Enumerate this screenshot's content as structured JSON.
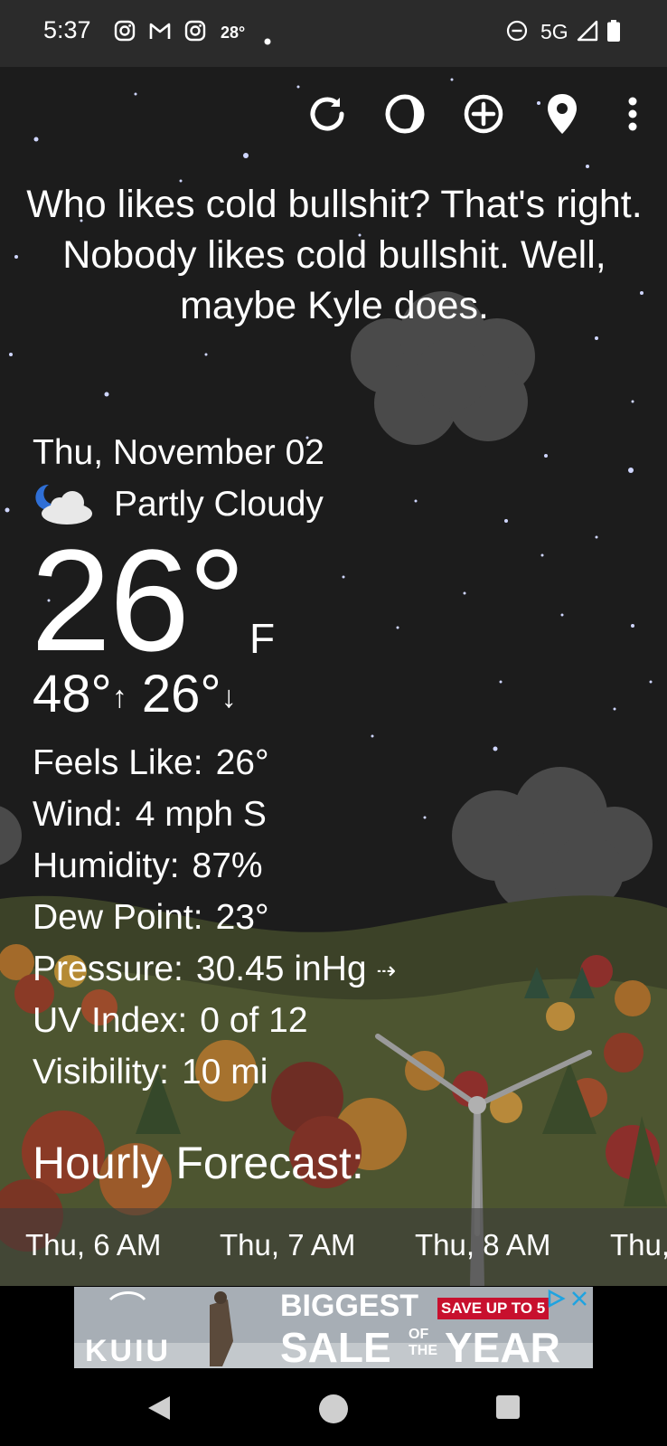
{
  "status_bar": {
    "time": "5:37",
    "temp_badge": "28°",
    "network": "5G",
    "notification_icons": [
      "instagram-icon",
      "gmail-icon",
      "instagram-icon",
      "temperature-badge",
      "dot-icon"
    ],
    "system_icons": [
      "do-not-disturb-icon",
      "signal-icon",
      "battery-icon"
    ]
  },
  "toolbar": {
    "icons": [
      "refresh-icon",
      "theme-icon",
      "add-location-icon",
      "location-pin-icon",
      "more-options-icon"
    ]
  },
  "quote": "Who likes cold bullshit? That's right. Nobody likes cold bullshit. Well, maybe Kyle does.",
  "current": {
    "date": "Thu, November 02",
    "condition": "Partly Cloudy",
    "condition_icon": "partly-cloudy-night-icon",
    "temperature": "26°",
    "unit": "F",
    "high": "48°",
    "low": "26°",
    "high_arrow": "↑",
    "low_arrow": "↓"
  },
  "details": [
    {
      "label": "Feels Like:",
      "value": "26°"
    },
    {
      "label": "Wind:",
      "value": "4 mph S"
    },
    {
      "label": "Humidity:",
      "value": "87%"
    },
    {
      "label": "Dew Point:",
      "value": "23°"
    },
    {
      "label": "Pressure:",
      "value": "30.45 inHg",
      "trend": "⇢"
    },
    {
      "label": "UV Index:",
      "value": "0 of 12"
    },
    {
      "label": "Visibility:",
      "value": "10 mi"
    }
  ],
  "hourly": {
    "title": "Hourly Forecast:",
    "hours": [
      "Thu, 6 AM",
      "Thu, 7 AM",
      "Thu, 8 AM",
      "Thu,"
    ]
  },
  "ad": {
    "brand": "KUIU",
    "headline_top": "BIGGEST",
    "headline_bottom": "SALE",
    "of": "OF",
    "the": "THE",
    "year": "YEAR",
    "badge": "SAVE UP TO 5",
    "colors": {
      "badge": "#c8102e",
      "text": "#ffffff"
    }
  },
  "nav": {
    "icons": [
      "back-icon",
      "home-icon",
      "recents-icon"
    ]
  },
  "colors": {
    "status_bg": "#2b2b2b",
    "sky": "#1c1c1c",
    "hill": "#4d5530"
  }
}
